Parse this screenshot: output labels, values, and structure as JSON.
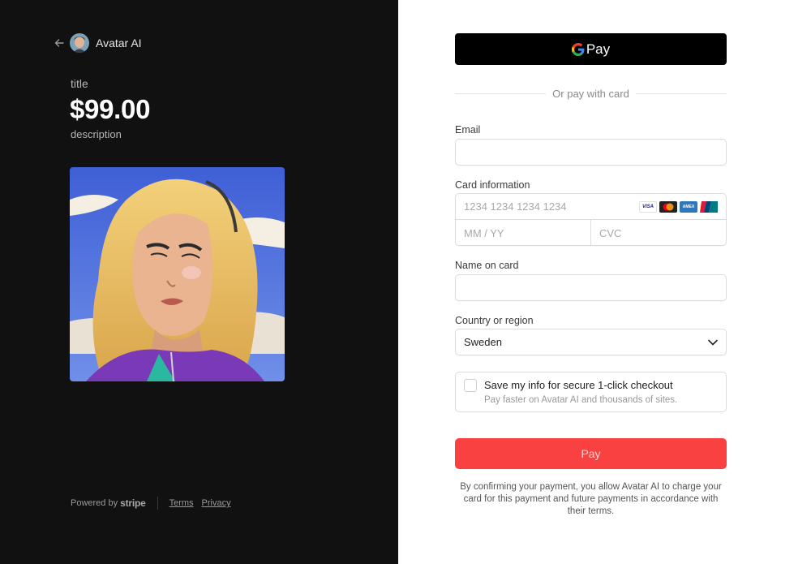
{
  "merchant": {
    "name": "Avatar AI"
  },
  "product": {
    "title": "title",
    "price": "$99.00",
    "description": "description"
  },
  "footer": {
    "powered_by": "Powered by",
    "stripe": "stripe",
    "terms": "Terms",
    "privacy": "Privacy"
  },
  "payment": {
    "gpay_label": "Pay",
    "divider_text": "Or pay with card",
    "email_label": "Email",
    "email_value": "",
    "card_label": "Card information",
    "card_number_placeholder": "1234 1234 1234 1234",
    "card_brands": [
      "VISA",
      "mastercard",
      "AMEX",
      "UnionPay"
    ],
    "expiry_placeholder": "MM / YY",
    "cvc_placeholder": "CVC",
    "name_label": "Name on card",
    "name_value": "",
    "country_label": "Country or region",
    "country_value": "Sweden",
    "save_title": "Save my info for secure 1-click checkout",
    "save_subtitle": "Pay faster on Avatar AI and thousands of sites.",
    "pay_button": "Pay",
    "legal_text": "By confirming your payment, you allow Avatar AI to charge your card for this payment and future payments in accordance with their terms."
  },
  "colors": {
    "left_bg": "#111111",
    "pay_button": "#fa4141",
    "gpay_bg": "#000000"
  }
}
